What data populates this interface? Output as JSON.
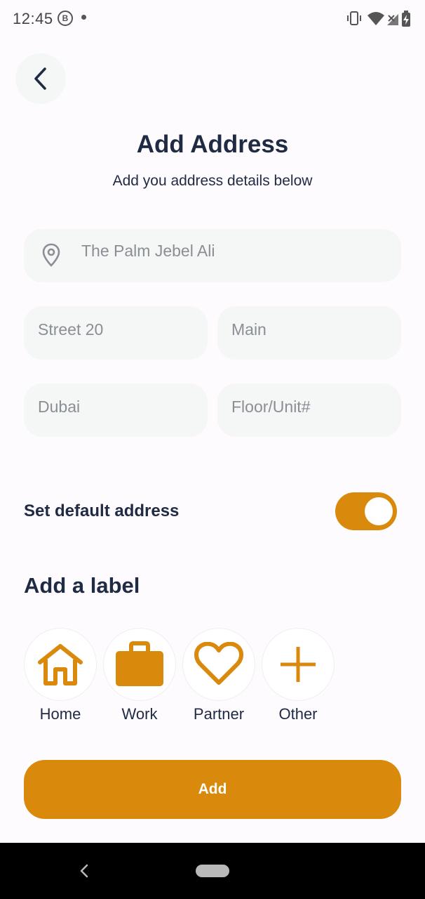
{
  "status_bar": {
    "time": "12:45",
    "b_badge": "B"
  },
  "header": {
    "title": "Add Address",
    "subtitle": "Add you address details below"
  },
  "form": {
    "location": {
      "value": "The Palm Jebel Ali",
      "icon": "location-pin-icon"
    },
    "street": {
      "value": "Street 20"
    },
    "building": {
      "value": "Main"
    },
    "city": {
      "value": "Dubai"
    },
    "floor_unit": {
      "placeholder": "Floor/Unit#"
    }
  },
  "default_address": {
    "label": "Set default address",
    "enabled": true
  },
  "labels": {
    "title": "Add a label",
    "items": [
      {
        "label": "Home",
        "icon": "home-icon"
      },
      {
        "label": "Work",
        "icon": "briefcase-icon"
      },
      {
        "label": "Partner",
        "icon": "heart-icon"
      },
      {
        "label": "Other",
        "icon": "plus-icon"
      }
    ]
  },
  "actions": {
    "add_label": "Add"
  },
  "colors": {
    "accent": "#d9890b",
    "text": "#1f2a44",
    "field_bg": "#f4f7f6",
    "background": "#fefbfe"
  }
}
